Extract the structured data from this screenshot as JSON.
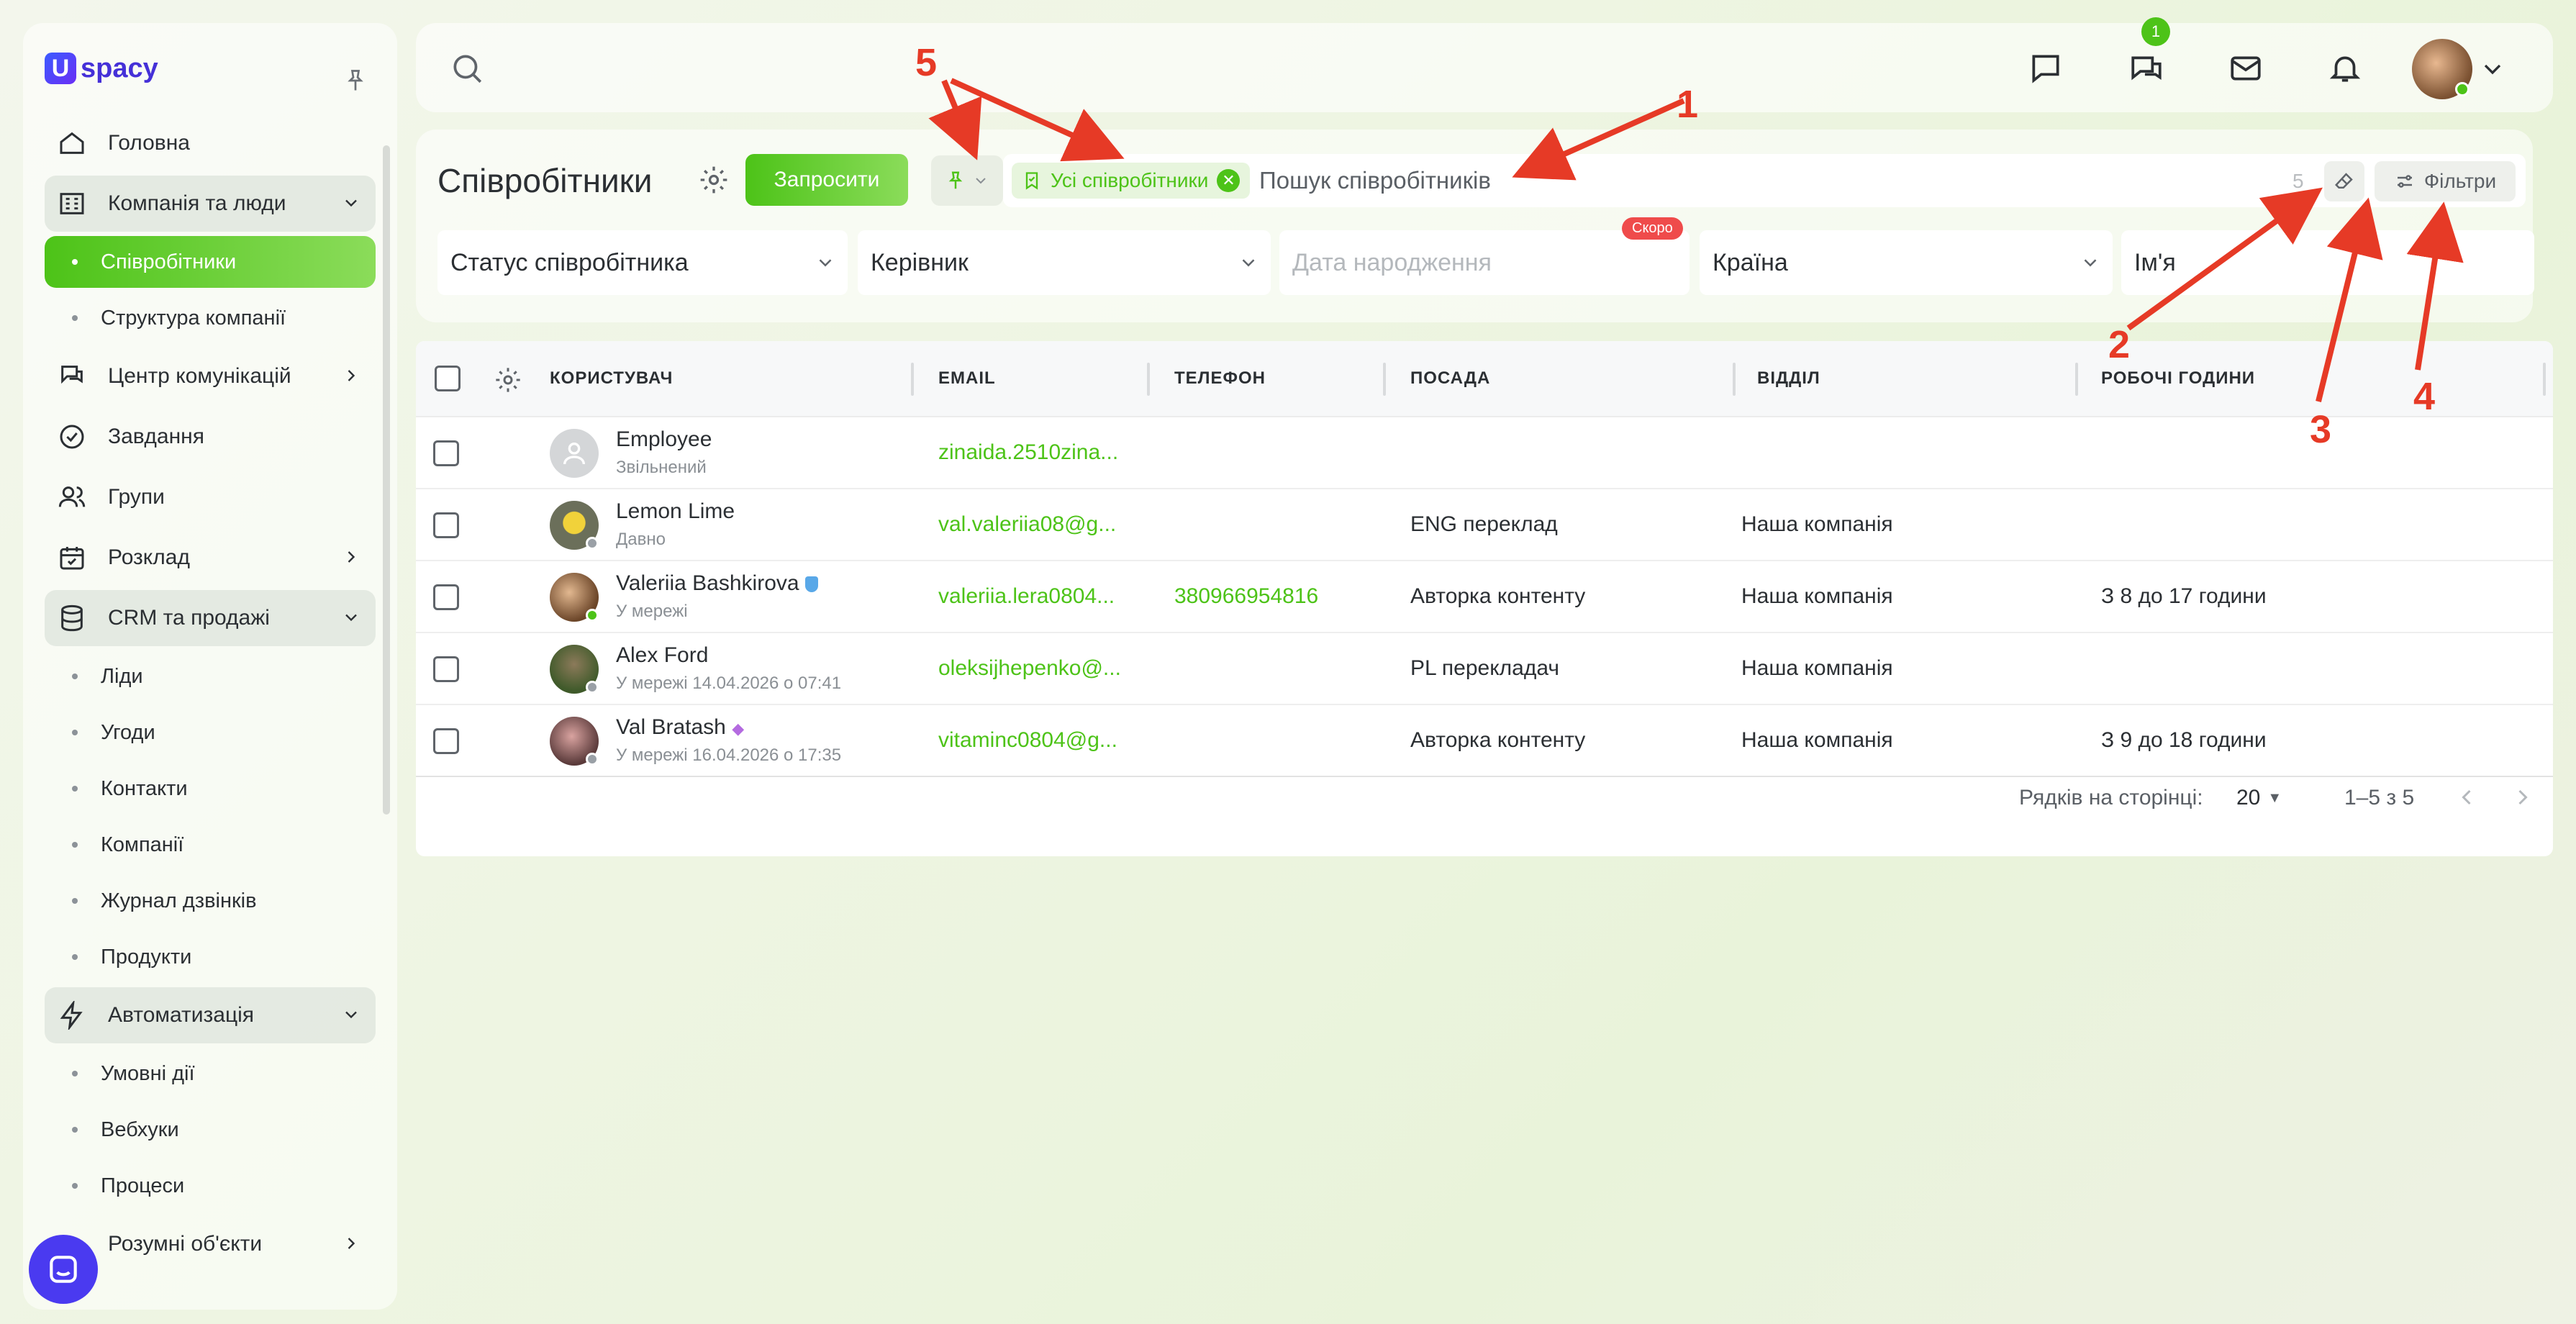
{
  "app": {
    "logo_letter": "U",
    "logo_text": "spacy"
  },
  "sidebar": {
    "items": [
      {
        "label": "Головна",
        "icon": "home-icon"
      },
      {
        "label": "Компанія та люди",
        "icon": "building-icon"
      },
      {
        "label": "Співробітники",
        "active": true
      },
      {
        "label": "Структура компанії"
      },
      {
        "label": "Центр комунікацій",
        "icon": "communication-icon"
      },
      {
        "label": "Завдання",
        "icon": "check-circle-icon"
      },
      {
        "label": "Групи",
        "icon": "users-icon"
      },
      {
        "label": "Розклад",
        "icon": "calendar-icon"
      },
      {
        "label": "CRM та продажі",
        "icon": "database-icon"
      },
      {
        "label": "Ліди"
      },
      {
        "label": "Угоди"
      },
      {
        "label": "Контакти"
      },
      {
        "label": "Компанії"
      },
      {
        "label": "Журнал дзвінків"
      },
      {
        "label": "Продукти"
      },
      {
        "label": "Автоматизація",
        "icon": "lightning-icon"
      },
      {
        "label": "Умовні дії"
      },
      {
        "label": "Вебхуки"
      },
      {
        "label": "Процеси"
      },
      {
        "label": "Розумні об'єкти"
      }
    ]
  },
  "topbar": {
    "chat_badge": "1"
  },
  "page": {
    "title": "Співробітники",
    "invite_label": "Запросити",
    "chip_label": "Усі співробітники",
    "search_placeholder": "Пошук співробітників",
    "result_count": "5",
    "filters_label": "Фільтри",
    "soon_label": "Скоро"
  },
  "filters": {
    "status": "Статус співробітника",
    "manager": "Керівник",
    "birthdate": "Дата народження",
    "country": "Країна",
    "name": "Ім'я"
  },
  "table": {
    "headers": [
      "КОРИСТУВАЧ",
      "EMAIL",
      "ТЕЛЕФОН",
      "ПОСАДА",
      "ВІДДІЛ",
      "РОБОЧІ ГОДИНИ"
    ],
    "rows": [
      {
        "name": "Employee",
        "status": "Звільнений",
        "email": "zinaida.2510zina...",
        "phone": "",
        "position": "",
        "department": "",
        "hours": ""
      },
      {
        "name": "Lemon Lime",
        "status": "Давно",
        "email": "val.valeriia08@g...",
        "phone": "",
        "position": "ENG переклад",
        "department": "Наша компанія",
        "hours": ""
      },
      {
        "name": "Valeriia Bashkirova",
        "status": "У мережі",
        "email": "valeriia.lera0804...",
        "phone": "380966954816",
        "position": "Авторка контенту",
        "department": "Наша компанія",
        "hours": "З 8 до 17 години"
      },
      {
        "name": "Alex Ford",
        "status": "У мережі 14.04.2026 о 07:41",
        "email": "oleksijhepenko@...",
        "phone": "",
        "position": "PL перекладач",
        "department": "Наша компанія",
        "hours": ""
      },
      {
        "name": "Val Bratash",
        "status": "У мережі 16.04.2026 о 17:35",
        "email": "vitaminc0804@g...",
        "phone": "",
        "position": "Авторка контенту",
        "department": "Наша компанія",
        "hours": "З 9 до 18 години"
      }
    ]
  },
  "pagination": {
    "rows_label": "Рядків на сторінці:",
    "rows_value": "20",
    "range": "1–5 з 5"
  },
  "annotations": [
    "1",
    "2",
    "3",
    "4",
    "5"
  ],
  "colors": {
    "accent": "#4dc318",
    "annotation": "#e63a26",
    "brand": "#4530d8"
  }
}
